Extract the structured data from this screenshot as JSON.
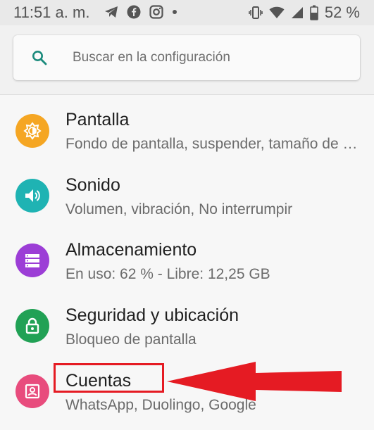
{
  "status_bar": {
    "time": "11:51 a. m.",
    "battery": "52 %",
    "left_icons": [
      "telegram-icon",
      "facebook-icon",
      "instagram-icon",
      "notification-dot-icon"
    ],
    "right_icons": [
      "vibrate-icon",
      "wifi-icon",
      "signal-icon",
      "battery-icon"
    ]
  },
  "search": {
    "placeholder": "Buscar en la configuración"
  },
  "settings": {
    "items": [
      {
        "title": "Pantalla",
        "subtitle": "Fondo de pantalla, suspender, tamaño de fuente",
        "icon": "brightness-icon",
        "color": "#f5a623"
      },
      {
        "title": "Sonido",
        "subtitle": "Volumen, vibración, No interrumpir",
        "icon": "volume-icon",
        "color": "#1fb3b3"
      },
      {
        "title": "Almacenamiento",
        "subtitle": "En uso: 62 % - Libre: 12,25 GB",
        "icon": "storage-icon",
        "color": "#9c3ed6"
      },
      {
        "title": "Seguridad y ubicación",
        "subtitle": "Bloqueo de pantalla",
        "icon": "lock-icon",
        "color": "#21a155"
      },
      {
        "title": "Cuentas",
        "subtitle": "WhatsApp, Duolingo, Google",
        "icon": "account-icon",
        "color": "#e84c7d"
      }
    ]
  },
  "annotation": {
    "highlight_color": "#e51b23",
    "target": "Cuentas"
  }
}
